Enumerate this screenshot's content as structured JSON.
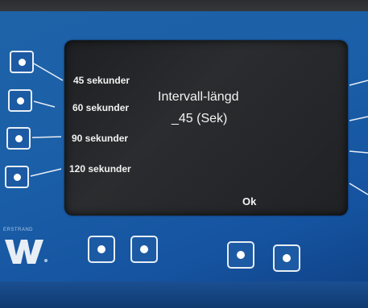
{
  "display": {
    "title_line1": "Intervall-längd",
    "title_line2": "_45 (Sek)",
    "ok_label": "Ok",
    "options": [
      "45 sekunder",
      "60 sekunder",
      "90 sekunder",
      "120 sekunder"
    ]
  },
  "brand": {
    "text": "ERSTRAND"
  },
  "colors": {
    "panel": "#1b5fa8",
    "screen": "#222427",
    "text": "#f4f4f4"
  }
}
